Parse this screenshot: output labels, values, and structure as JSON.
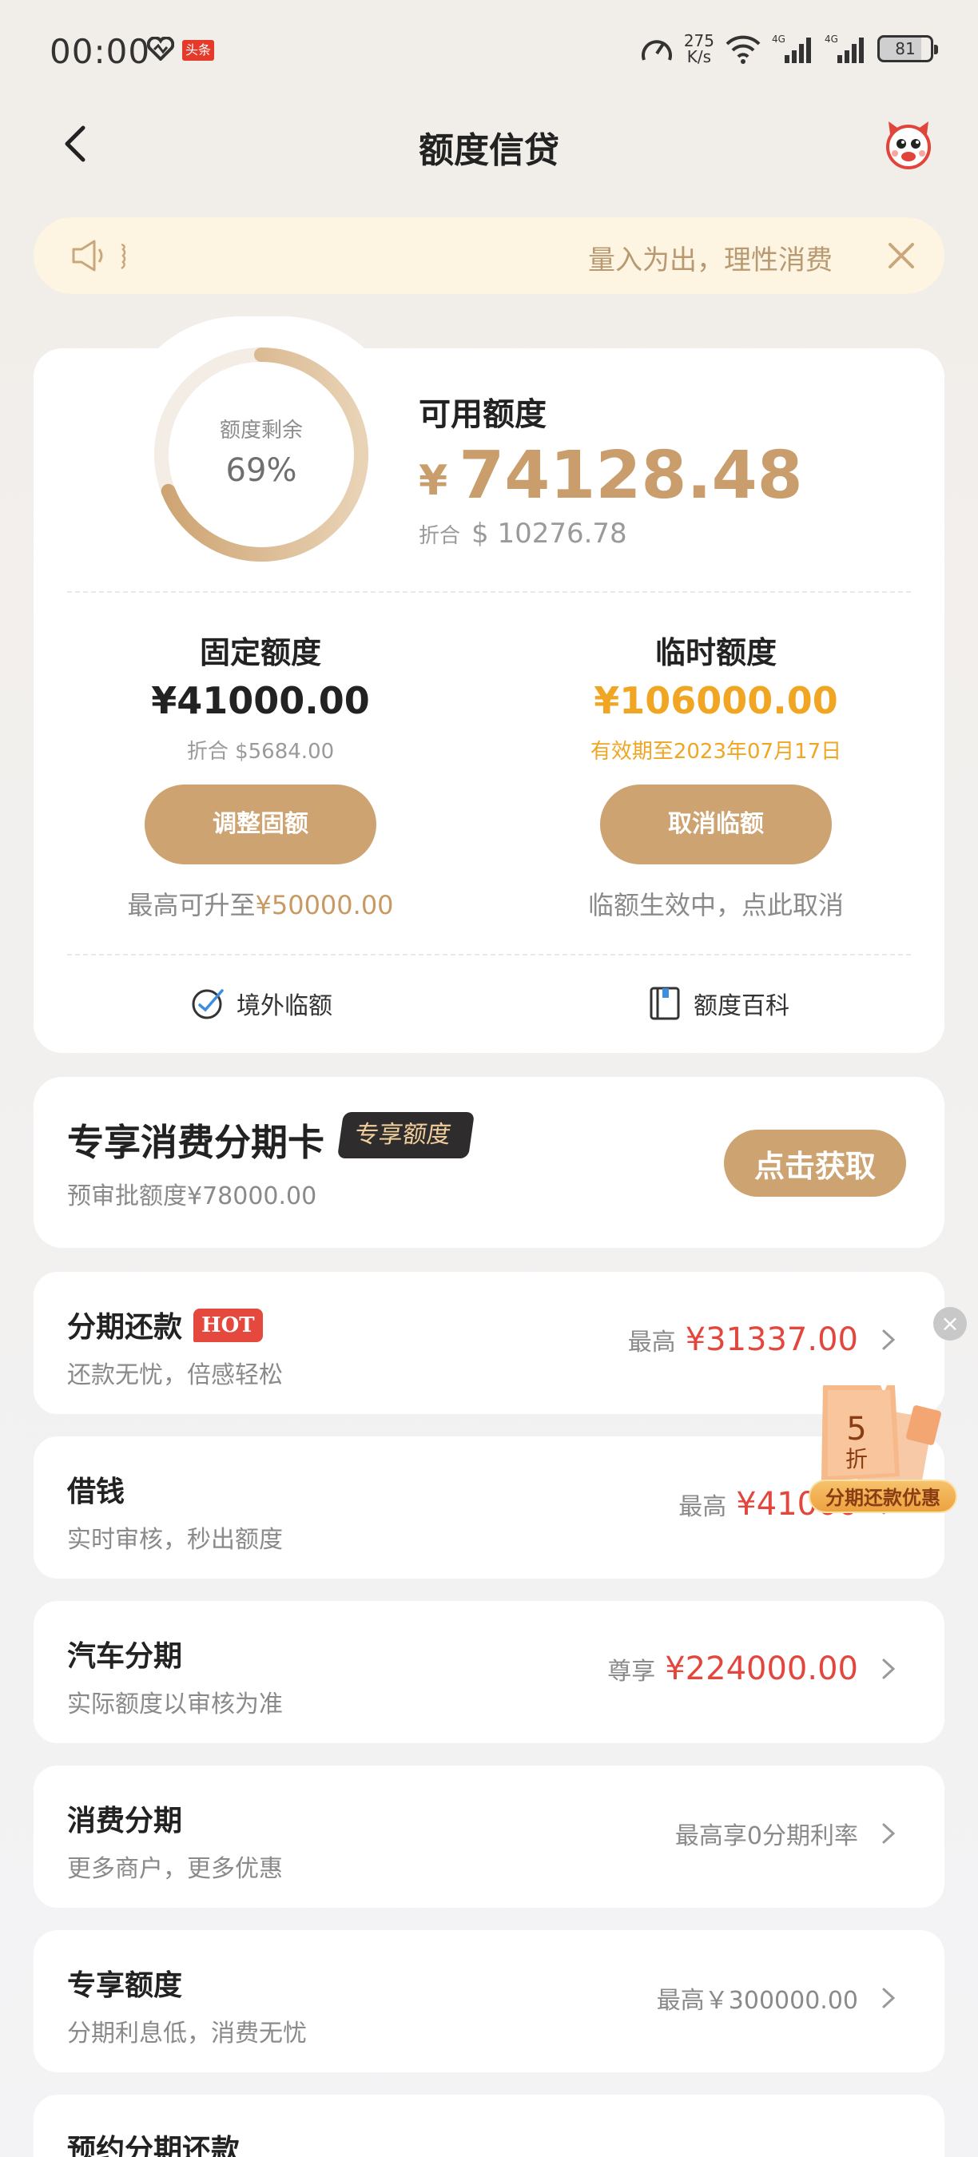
{
  "status_bar": {
    "time": "00:00",
    "news_badge": "头条",
    "speed_value": "275",
    "speed_unit": "K/s",
    "net1": "4G",
    "net2": "4G",
    "battery": "81"
  },
  "nav": {
    "title": "额度信贷"
  },
  "notice": {
    "text": "量入为出，理性消费"
  },
  "credit": {
    "ring_label": "额度剩余",
    "ring_value": "69%",
    "ring_fraction": 0.69,
    "available_label": "可用额度",
    "available_currency": "¥",
    "available_amount": "74128.48",
    "converted_label": "折合",
    "converted_amount": "$ 10276.78",
    "fixed": {
      "title": "固定额度",
      "amount": "¥41000.00",
      "converted": "折合 $5684.00",
      "button": "调整固额",
      "note_prefix": "最高可升至",
      "note_value": "¥50000.00"
    },
    "temporary": {
      "title": "临时额度",
      "amount": "¥106000.00",
      "valid_until": "有效期至2023年07月17日",
      "button": "取消临额",
      "note": "临额生效中，点此取消"
    },
    "tools": [
      {
        "label": "境外临额",
        "icon": "overseas-limit-icon"
      },
      {
        "label": "额度百科",
        "icon": "book-icon"
      }
    ]
  },
  "promo": {
    "title": "专享消费分期卡",
    "badge": "专享额度",
    "subtitle": "预审批额度¥78000.00",
    "button": "点击获取"
  },
  "rows": [
    {
      "title": "分期还款",
      "badge": "HOT",
      "subtitle": "还款无忧，倍感轻松",
      "prefix": "最高",
      "amount": "¥31337.00"
    },
    {
      "title": "借钱",
      "subtitle": "实时审核，秒出额度",
      "prefix": "最高",
      "amount": "¥41000"
    },
    {
      "title": "汽车分期",
      "subtitle": "实际额度以审核为准",
      "prefix": "尊享",
      "amount": "¥224000.00"
    },
    {
      "title": "消费分期",
      "subtitle": "更多商户，更多优惠",
      "plain": "最高享0分期利率"
    },
    {
      "title": "专享额度",
      "subtitle": "分期利息低，消费无忧",
      "plain": "最高￥300000.00"
    },
    {
      "title": "预约分期还款"
    }
  ],
  "floating": {
    "coupon_number": "5",
    "coupon_unit": "折",
    "label": "分期还款优惠"
  },
  "colors": {
    "gold": "#cda371",
    "amount_gold": "#c99d6c",
    "temp_orange": "#f0a623",
    "red": "#e2463d"
  }
}
